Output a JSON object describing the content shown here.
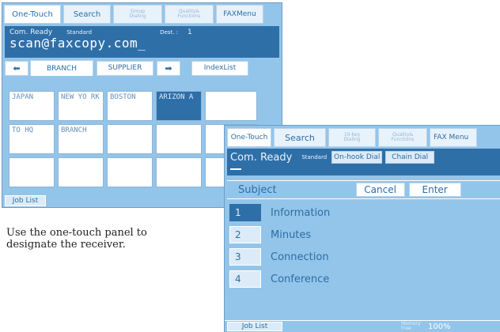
{
  "panel1": {
    "tabs": [
      "One-Touch",
      "Search",
      "Group Dialing",
      "Quality & Functions",
      "FAXMenu"
    ],
    "tab_small": {
      "t3": [
        "Group",
        "Dialing"
      ],
      "t4": [
        "Quality&",
        "Functions"
      ]
    },
    "status": {
      "ready": "Com. Ready",
      "mode": "Standard",
      "dest_label": "Dest. :",
      "dest_value": "1",
      "address": "scan@faxcopy.com_"
    },
    "nav": {
      "left_arrow": "⬅",
      "right_arrow": "➡",
      "index_list": "IndexList"
    },
    "group_tabs": [
      "BRANCH",
      "SUPPLIER"
    ],
    "grid": [
      [
        "JAPAN",
        "NEW YO RK",
        "BOSTON",
        "ARIZON A",
        ""
      ],
      [
        "TO HQ",
        "BRANCH",
        "",
        "",
        ""
      ],
      [
        "",
        "",
        "",
        "",
        ""
      ]
    ],
    "job_list": "Job List"
  },
  "caption": "Use the one-touch panel to designate the receiver.",
  "panel2": {
    "tabs": [
      "One-Touch",
      "Search",
      "10-key Dialing",
      "Quality & Functions",
      "FAX Menu"
    ],
    "tab_small": {
      "t3": [
        "10-key",
        "Dialing"
      ],
      "t4": [
        "Quality&",
        "Functions"
      ]
    },
    "status": {
      "ready": "Com. Ready",
      "mode": "Standard",
      "onhook": "On-hook Dial",
      "chain": "Chain Dial"
    },
    "subject_label": "Subject",
    "cancel": "Cancel",
    "enter": "Enter",
    "items": [
      {
        "num": "1",
        "label": "Information"
      },
      {
        "num": "2",
        "label": "Minutes"
      },
      {
        "num": "3",
        "label": "Connection"
      },
      {
        "num": "4",
        "label": "Conference"
      }
    ],
    "job_list": "Job List",
    "memory_label": "Memory Free",
    "memory_value": "100%"
  },
  "colors": {
    "panel_bg": "#93c5ea",
    "dark_blue": "#2f6fa8",
    "text_blue": "#2e6da4"
  }
}
